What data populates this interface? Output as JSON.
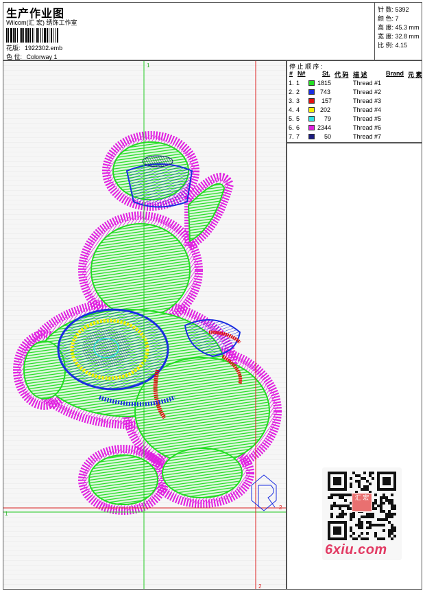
{
  "header": {
    "title": "生产作业图",
    "company": "Wilcom(汇 宏) 绣饰工作室",
    "design_label": "花版:",
    "design_value": "1922302.emb",
    "colorway_label": "色 位:",
    "colorway_value": "Colorway 1"
  },
  "stats": [
    {
      "label": "针 数:",
      "value": "5392"
    },
    {
      "label": "颜 色:",
      "value": "7"
    },
    {
      "label": "高 度:",
      "value": "45.3 mm"
    },
    {
      "label": "宽 度:",
      "value": "32.8 mm"
    },
    {
      "label": "比 例:",
      "value": "4.15"
    }
  ],
  "guides": {
    "vertical_green_label": "1",
    "horizontal_green_label": "1",
    "vertical_red_label": "2",
    "horizontal_red_label": "2"
  },
  "threads": {
    "heading": "停 止 顺 序 :",
    "columns": [
      "#",
      "N#",
      "St.",
      "代 码",
      "描 述",
      "Brand",
      "元 素"
    ],
    "rows": [
      {
        "num": "1.",
        "n": "1",
        "st": "1815",
        "desc": "Thread #1",
        "color": "#22dd22"
      },
      {
        "num": "2.",
        "n": "2",
        "st": "743",
        "desc": "Thread #2",
        "color": "#1a2ee0"
      },
      {
        "num": "3.",
        "n": "3",
        "st": "157",
        "desc": "Thread #3",
        "color": "#e01010"
      },
      {
        "num": "4.",
        "n": "4",
        "st": "202",
        "desc": "Thread #4",
        "color": "#f5f000"
      },
      {
        "num": "5.",
        "n": "5",
        "st": "79",
        "desc": "Thread #5",
        "color": "#30e0e0"
      },
      {
        "num": "6.",
        "n": "6",
        "st": "2344",
        "desc": "Thread #6",
        "color": "#e020e0"
      },
      {
        "num": "7.",
        "n": "7",
        "st": "50",
        "desc": "Thread #7",
        "color": "#1c1c80"
      }
    ]
  },
  "qr_badge_text": "汇 宏",
  "watermark": "6xiu.com"
}
